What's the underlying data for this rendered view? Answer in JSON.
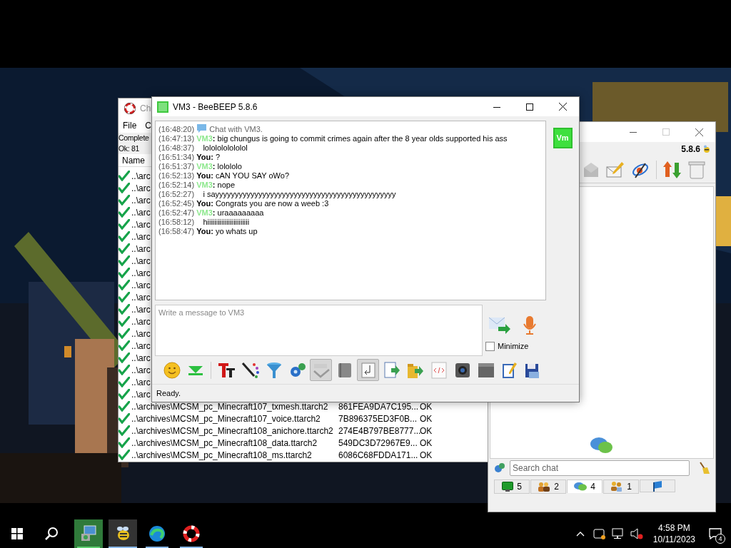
{
  "checker_window": {
    "title": "Ch",
    "menu": [
      "File",
      "C"
    ],
    "summary": [
      "Complete",
      "Ok: 81"
    ],
    "columns": [
      "Name"
    ],
    "rows": [
      {
        "name": "..\\arc"
      },
      {
        "name": "..\\arc"
      },
      {
        "name": "..\\arc"
      },
      {
        "name": "..\\arc"
      },
      {
        "name": "..\\arc"
      },
      {
        "name": "..\\arc"
      },
      {
        "name": "..\\arc"
      },
      {
        "name": "..\\arc"
      },
      {
        "name": "..\\arc"
      },
      {
        "name": "..\\arc"
      },
      {
        "name": "..\\arc"
      },
      {
        "name": "..\\arc"
      },
      {
        "name": "..\\arc"
      },
      {
        "name": "..\\arc"
      },
      {
        "name": "..\\arc"
      },
      {
        "name": "..\\arc"
      },
      {
        "name": "..\\arc"
      },
      {
        "name": "..\\arc"
      },
      {
        "name": "..\\arc"
      },
      {
        "name": "..\\archives\\MCSM_pc_Minecraft107_txmesh.ttarch2",
        "hash": "861FEA9DA7C195...",
        "result": "OK"
      },
      {
        "name": "..\\archives\\MCSM_pc_Minecraft107_voice.ttarch2",
        "hash": "7B896375ED3F0B...",
        "result": "OK"
      },
      {
        "name": "..\\archives\\MCSM_pc_Minecraft108_anichore.ttarch2",
        "hash": "274E4B797BE8777...",
        "result": "OK"
      },
      {
        "name": "..\\archives\\MCSM_pc_Minecraft108_data.ttarch2",
        "hash": "549DC3D72967E9...",
        "result": "OK"
      },
      {
        "name": "..\\archives\\MCSM_pc_Minecraft108_ms.ttarch2",
        "hash": "6086C68FDDA171...",
        "result": "OK"
      }
    ]
  },
  "chat_window": {
    "title": "VM3 - BeeBEEP 5.8.6",
    "avatar": "Vm",
    "messages": [
      {
        "kind": "system",
        "time": "(16:48:20)",
        "text": "Chat with VM3."
      },
      {
        "kind": "peer",
        "time": "(16:47:13)",
        "sender": "VM3",
        "text": "**:** big chungus is going to commit crimes again after the 8 year olds supported his ass"
      },
      {
        "kind": "continuation",
        "time": "(16:48:37)",
        "text": "lololololololol"
      },
      {
        "kind": "self",
        "time": "(16:51:34)",
        "sender": "You:",
        "text": "?"
      },
      {
        "kind": "peer",
        "time": "(16:51:37)",
        "sender": "VM3",
        "text": "**:** lolololo"
      },
      {
        "kind": "self",
        "time": "(16:52:13)",
        "sender": "You:",
        "text": "cAN YOU SAY oWo?"
      },
      {
        "kind": "peer",
        "time": "(16:52:14)",
        "sender": "VM3",
        "text": "**:** nope"
      },
      {
        "kind": "continuation",
        "time": "(16:52:27)",
        "text": "i sayyyyyyyyyyyyyyyyyyyyyyyyyyyyyyyyyyyyyyyyyyyyyy"
      },
      {
        "kind": "self",
        "time": "(16:52:45)",
        "sender": "You:",
        "text": "Congrats you are now a weeb :3"
      },
      {
        "kind": "peer",
        "time": "(16:52:47)",
        "sender": "VM3",
        "text": "**:** uraaaaaaaaa"
      },
      {
        "kind": "continuation",
        "time": "(16:58:12)",
        "text": "hiiiiiiiiiiiiiiiiiiiiiiii"
      },
      {
        "kind": "self",
        "time": "(16:58:47)",
        "sender": "You:",
        "text": "yo whats up"
      }
    ],
    "input": {
      "placeholder": "Write a message to VM3"
    },
    "minimize": {
      "label": "Minimize",
      "checked": false
    },
    "toolbar": [
      {
        "on": false
      },
      {
        "on": false
      },
      {
        "on": false
      },
      {
        "on": false
      },
      {
        "on": false
      },
      {
        "on": false
      },
      {
        "on": true
      },
      {
        "on": false
      },
      {
        "on": true
      },
      {
        "on": false
      },
      {
        "on": false
      },
      {
        "on": false
      },
      {
        "on": false
      },
      {
        "on": false
      },
      {
        "on": false
      },
      {
        "on": false
      }
    ],
    "status": "Ready."
  },
  "main_window": {
    "version": "5.8.6",
    "search": {
      "placeholder": "Search chat"
    },
    "tabs": [
      {
        "count": "5",
        "selected": false
      },
      {
        "count": "2",
        "selected": false
      },
      {
        "count": "4",
        "selected": true
      },
      {
        "count": "1",
        "selected": false
      },
      {
        "selected": false
      }
    ]
  },
  "taskbar": {
    "apps": [
      {
        "flashing": true,
        "selected": false
      },
      {
        "flashing": false,
        "selected": true
      },
      {
        "flashing": false,
        "selected": false
      },
      {
        "flashing": false,
        "selected": false
      }
    ],
    "time": "4:58 PM",
    "date": "10/11/2023",
    "notifications": "4"
  }
}
